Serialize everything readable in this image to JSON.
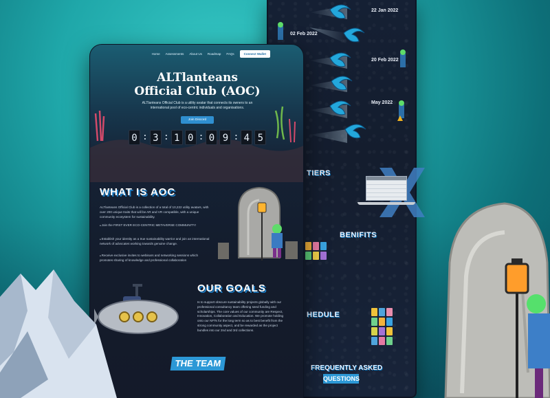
{
  "nav": {
    "items": [
      "Home",
      "Assessments",
      "About Us",
      "Roadmap",
      "FAQs"
    ],
    "connect_label": "Connect Wallet"
  },
  "hero": {
    "title": "ALTlanteans Official Club (AOC)",
    "subtitle": "ALTlanteans Official Club is a utility avatar that connects its owners to an international pool of eco-centric individuals and organisations.",
    "join_label": "Join Discord",
    "countdown": [
      "0",
      "3",
      "1",
      "0",
      "0",
      "9",
      "4",
      "5"
    ]
  },
  "what_is": {
    "title": "WHAT IS AOC",
    "intro": "ALTlanteans Official Club is a collection of a total of 10,222 utility avatars, with over 200 unique traits that will be AR and VR compatible, with a unique community ecosystem for sustainability.",
    "bullets": [
      "Join the FIRST EVER ECO-CENTRIC METAVERSE COMMUNITY!",
      "Establish your identity as a true sustainability warrior and join an international network of advocates working towards genuine change.",
      "Receive exclusive invites to webinars and networking sessions which promotes sharing of knowledge and professional collaboration"
    ]
  },
  "goals": {
    "title": "OUR GOALS",
    "text": "Is to support obscure sustainability projects globally with our professional consultancy team offering seed funding and scholarships. The core values of our community are Respect, Innovation, Collaboration and Education. We promote holding onto our NFTs for the long term so as to best benefit from the strong community aspect, and be rewarded as the project bundles into our 2nd and 3rd collections."
  },
  "team": {
    "title": "THE TEAM"
  },
  "timeline": {
    "dates": [
      "22 Jan 2022",
      "02 Feb 2022",
      "20 Feb 2022",
      "May 2022"
    ]
  },
  "back_sections": {
    "tiers": "TIERS",
    "benefits": "BENIFITS",
    "schedule": "HEDULE",
    "faq_line1": "FREQUENTLY ASKED",
    "faq_line2": "QUESTIONS"
  },
  "colors": {
    "accent": "#2c98d6",
    "background": "#1fa7a9",
    "page_dark": "#141c2c"
  }
}
